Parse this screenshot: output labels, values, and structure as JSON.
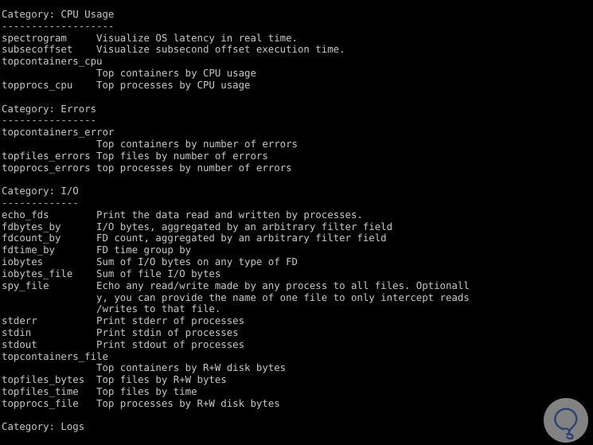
{
  "terminal": {
    "background_color": "#000000",
    "foreground_color": "#c6c6c6",
    "lines": [
      "Category: CPU Usage",
      "-------------------",
      "spectrogram     Visualize OS latency in real time.",
      "subsecoffset    Visualize subsecond offset execution time.",
      "topcontainers_cpu",
      "                Top containers by CPU usage",
      "topprocs_cpu    Top processes by CPU usage",
      "",
      "Category: Errors",
      "----------------",
      "topcontainers_error",
      "                Top containers by number of errors",
      "topfiles_errors Top files by number of errors",
      "topprocs_errors top processes by number of errors",
      "",
      "Category: I/O",
      "-------------",
      "echo_fds        Print the data read and written by processes.",
      "fdbytes_by      I/O bytes, aggregated by an arbitrary filter field",
      "fdcount_by      FD count, aggregated by an arbitrary filter field",
      "fdtime_by       FD time group by",
      "iobytes         Sum of I/O bytes on any type of FD",
      "iobytes_file    Sum of file I/O bytes",
      "spy_file        Echo any read/write made by any process to all files. Optionall",
      "                y, you can provide the name of one file to only intercept reads",
      "                /writes to that file.",
      "stderr          Print stderr of processes",
      "stdin           Print stdin of processes",
      "stdout          Print stdout of processes",
      "topcontainers_file",
      "                Top containers by R+W disk bytes",
      "topfiles_bytes  Top files by R+W bytes",
      "topfiles_time   Top files by time",
      "topprocs_file   Top processes by R+W disk bytes",
      "",
      "Category: Logs"
    ]
  },
  "watermark": {
    "icon": "lightbulb-icon",
    "circle_color": "#8e8e8e",
    "glyph_color": "#2b4a7d"
  }
}
